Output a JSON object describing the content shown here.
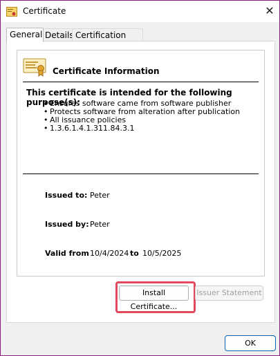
{
  "window": {
    "title": "Certificate",
    "icon": "certificate-icon",
    "close_icon": "close-icon",
    "close_glyph": "✕"
  },
  "tabs": [
    {
      "label": "General",
      "active": true
    },
    {
      "label": "Details",
      "active": false
    },
    {
      "label": "Certification Path",
      "active": false
    }
  ],
  "info": {
    "heading": "Certificate Information",
    "purpose_heading": "This certificate is intended for the following purpose(s):",
    "purposes": [
      "Ensures software came from software publisher",
      "Protects software from alteration after publication",
      "All issuance policies",
      "1.3.6.1.4.1.311.84.3.1"
    ],
    "issued_to_label": "Issued to:",
    "issued_to_value": "Peter",
    "issued_by_label": "Issued by:",
    "issued_by_value": "Peter",
    "valid_from_label": "Valid from",
    "valid_from_value": "10/4/2024",
    "valid_to_label": "to",
    "valid_to_value": "10/5/2025"
  },
  "buttons": {
    "install": "Install Certificate...",
    "issuer_statement": "Issuer Statement",
    "ok": "OK"
  },
  "colors": {
    "window_border": "#8e1f7e",
    "highlight": "#e0495e",
    "ok_border": "#0063b1"
  }
}
